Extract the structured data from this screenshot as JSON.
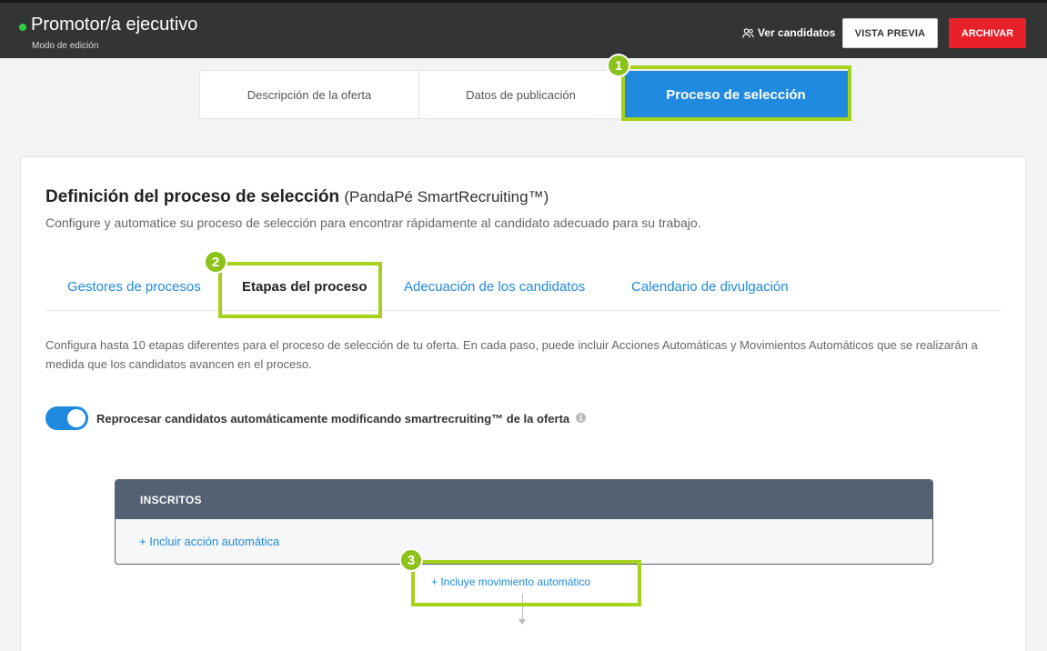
{
  "header": {
    "title": "Promotor/a ejecutivo",
    "mode": "Modo de edición",
    "view_candidates": "Ver candidatos",
    "preview_button": "VISTA PREVIA",
    "archive_button": "ARCHIVAR"
  },
  "main_tabs": [
    {
      "label": "Descripción de la oferta"
    },
    {
      "label": "Datos de publicación"
    },
    {
      "label": "Proceso de selección",
      "active": true
    }
  ],
  "section": {
    "title_bold": "Definición del proceso de selección",
    "title_suffix": "(PandaPé SmartRecruiting™)",
    "subtitle": "Configure y automatice su proceso de selección para encontrar rápidamente al candidato adecuado para su trabajo."
  },
  "sub_tabs": [
    {
      "label": "Gestores de procesos"
    },
    {
      "label": "Etapas del proceso",
      "active": true
    },
    {
      "label": "Adecuación de los candidatos"
    },
    {
      "label": "Calendario de divulgación"
    }
  ],
  "description": "Configura hasta 10 etapas diferentes para el proceso de selección de tu oferta. En cada paso, puede incluir Acciones Automáticas y Movimientos Automáticos que se realizarán a medida que los candidatos avancen en el proceso.",
  "toggle": {
    "label": "Reprocesar candidatos automáticamente modificando smartrecruiting™ de la oferta",
    "enabled": true
  },
  "stage": {
    "name": "INSCRITOS",
    "add_action": "+ Incluir acción automática",
    "add_movement": "+ Incluye movimiento automático"
  },
  "highlights": [
    "1",
    "2",
    "3"
  ],
  "colors": {
    "accent": "#1f8ae0",
    "archive": "#e8202a",
    "highlight": "#a6d21a",
    "stage_header": "#536172"
  }
}
